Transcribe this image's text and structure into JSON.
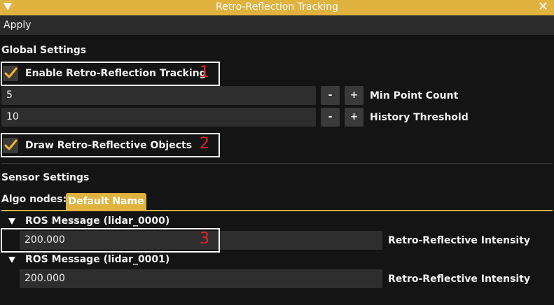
{
  "window": {
    "title": "Retro-Reflection Tracking",
    "close_glyph": "✕"
  },
  "menu": {
    "apply_label": "Apply"
  },
  "global_settings": {
    "header": "Global Settings",
    "enable_tracking": {
      "label": "Enable Retro-Reflection Tracking",
      "checked": true
    },
    "min_point_count": {
      "value": "5",
      "label": "Min Point Count",
      "minus": "-",
      "plus": "+"
    },
    "history_threshold": {
      "value": "10",
      "label": "History Threshold",
      "minus": "-",
      "plus": "+"
    },
    "draw_objects": {
      "label": "Draw Retro-Reflective Objects",
      "checked": true
    }
  },
  "sensor_settings": {
    "header": "Sensor Settings",
    "algo_nodes_label": "Algo nodes:",
    "tabs": [
      {
        "label": "Default Name",
        "active": true
      }
    ],
    "nodes": [
      {
        "label": "ROS Message (lidar_0000)",
        "value": "200.000",
        "field_label": "Retro-Reflective Intensity"
      },
      {
        "label": "ROS Message (lidar_0001)",
        "value": "200.000",
        "field_label": "Retro-Reflective Intensity"
      }
    ]
  },
  "annotations": [
    "1",
    "2",
    "3"
  ],
  "colors": {
    "accent": "#e0b23e",
    "checkmark": "#f0b429",
    "annotation": "#e02424"
  }
}
